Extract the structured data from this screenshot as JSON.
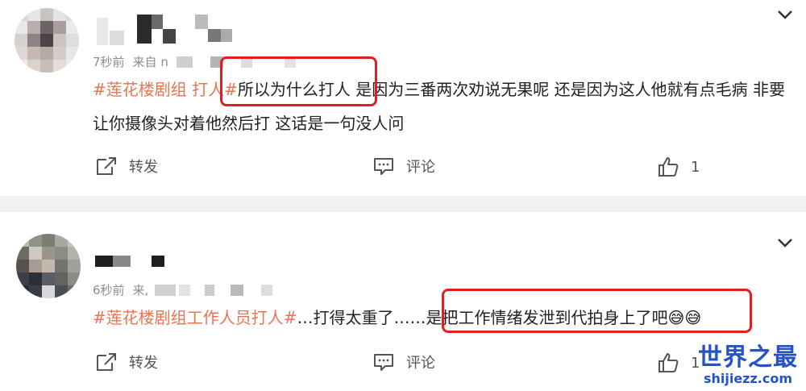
{
  "posts": [
    {
      "time": "7秒前",
      "source_prefix": "来自 n",
      "content_topic": "#莲花楼剧组 打人#",
      "content_text": "所以为什么打人 是因为三番两次劝说无果呢 还是因为这人他就有点毛病 非要让你摄像头对着他然后打 这话是一句没人问",
      "repost_label": "转发",
      "comment_label": "评论",
      "like_count": "1"
    },
    {
      "time": "6秒前",
      "source_prefix": "来,",
      "content_topic": "#莲花楼剧组工作人员打人#",
      "content_text": "…打得太重了……是把工作情绪发泄到代拍身上了吧😅😅",
      "repost_label": "转发",
      "comment_label": "评论",
      "like_count": "1"
    }
  ],
  "watermark": {
    "title": "世界之最",
    "url": "shijiezz.com"
  },
  "colors": {
    "topic": "#eb7350",
    "highlight_box": "#e02020",
    "divider": "#f1f1f1",
    "watermark": "#2453c9"
  },
  "icons": [
    "chevron-down-icon",
    "repost-icon",
    "comment-icon",
    "like-icon"
  ]
}
